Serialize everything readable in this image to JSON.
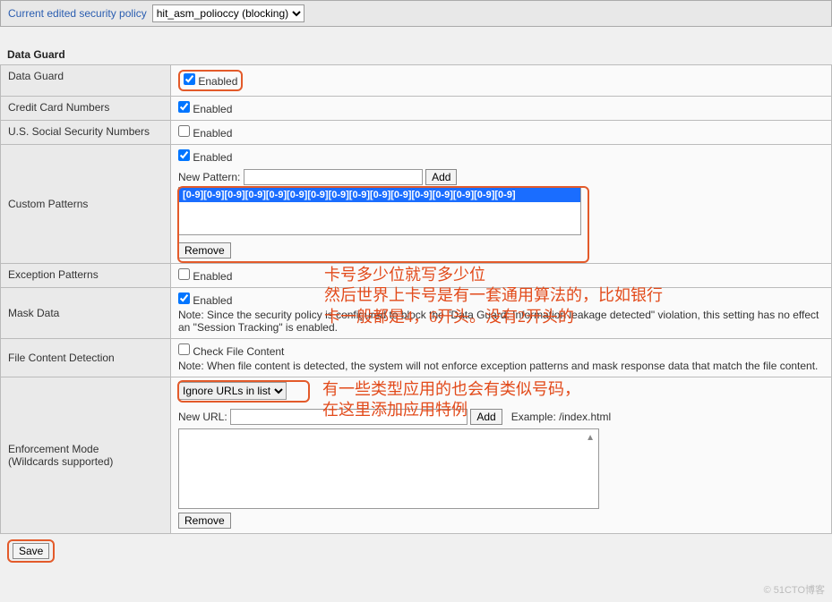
{
  "topbar": {
    "label": "Current edited security policy",
    "dropdown_value": "hit_asm_polioccy (blocking)"
  },
  "section_title": "Data Guard",
  "rows": {
    "data_guard": {
      "label": "Data Guard",
      "enabled_text": "Enabled"
    },
    "cc": {
      "label": "Credit Card Numbers",
      "enabled_text": "Enabled"
    },
    "ssn": {
      "label": "U.S. Social Security Numbers",
      "enabled_text": "Enabled"
    },
    "custom": {
      "label": "Custom Patterns",
      "enabled_text": "Enabled",
      "new_pattern_label": "New Pattern:",
      "add_btn": "Add",
      "pattern_value": "[0-9][0-9][0-9][0-9][0-9][0-9][0-9][0-9][0-9][0-9][0-9][0-9][0-9][0-9][0-9][0-9]",
      "remove_btn": "Remove"
    },
    "exception": {
      "label": "Exception Patterns",
      "enabled_text": "Enabled"
    },
    "mask": {
      "label": "Mask Data",
      "enabled_text": "Enabled",
      "note": "Note: Since the security policy is configured to block the \"Data Guard: Information leakage detected\" violation, this setting has no effect an \"Session Tracking\" is enabled."
    },
    "file_content": {
      "label": "File Content Detection",
      "check_text": "Check File Content",
      "note": "Note: When file content is detected, the system will not enforce exception patterns and mask response data that match the file content."
    },
    "enforcement": {
      "label_line1": "Enforcement Mode",
      "label_line2": "(Wildcards supported)",
      "ignore_dropdown": "Ignore URLs in list",
      "new_url_label": "New URL:",
      "add_btn": "Add",
      "example": "Example: /index.html",
      "remove_btn": "Remove"
    }
  },
  "save_btn": "Save",
  "annotations": {
    "a1_line1": "卡号多少位就写多少位",
    "a1_line2": "然后世界上卡号是有一套通用算法的，比如银行",
    "a1_line3": "卡一般都是4，6开头。没有2开头的",
    "a2_line1": "有一些类型应用的也会有类似号码，",
    "a2_line2": "在这里添加应用特例"
  },
  "watermark": "© 51CTO博客"
}
